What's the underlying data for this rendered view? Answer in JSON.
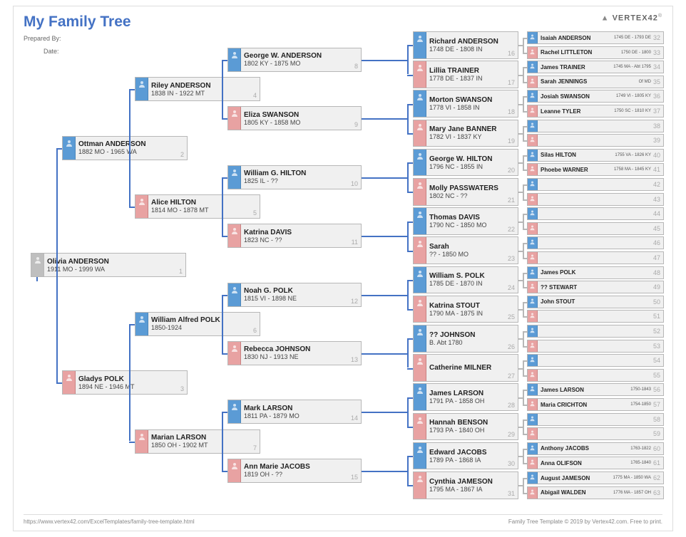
{
  "header": {
    "title": "My Family Tree",
    "prepared_by_label": "Prepared By:",
    "date_label": "Date:",
    "logo": "VERTEX42"
  },
  "footer": {
    "left": "https://www.vertex42.com/ExcelTemplates/family-tree-template.html",
    "right": "Family Tree Template © 2019 by Vertex42.com. Free to print."
  },
  "root": {
    "name": "Olivia ANDERSON",
    "dates": "1911 MO - 1999 WA",
    "num": "1"
  },
  "g2": [
    {
      "name": "Ottman ANDERSON",
      "dates": "1882 MO - 1965 WA",
      "num": "2",
      "sex": "m"
    },
    {
      "name": "Gladys POLK",
      "dates": "1894 NE - 1946 MT",
      "num": "3",
      "sex": "f"
    }
  ],
  "g3": [
    {
      "name": "Riley ANDERSON",
      "dates": "1838 IN - 1922 MT",
      "num": "4",
      "sex": "m"
    },
    {
      "name": "Alice HILTON",
      "dates": "1814 MO - 1878 MT",
      "num": "5",
      "sex": "f"
    },
    {
      "name": "William Alfred POLK",
      "dates": "1850-1924",
      "num": "6",
      "sex": "m"
    },
    {
      "name": "Marian LARSON",
      "dates": "1850 OH - 1902 MT",
      "num": "7",
      "sex": "f"
    }
  ],
  "g4": [
    {
      "name": "George W. ANDERSON",
      "dates": "1802 KY - 1875 MO",
      "num": "8",
      "sex": "m"
    },
    {
      "name": "Eliza SWANSON",
      "dates": "1805 KY - 1858 MO",
      "num": "9",
      "sex": "f"
    },
    {
      "name": "William G. HILTON",
      "dates": "1825 IL - ??",
      "num": "10",
      "sex": "m"
    },
    {
      "name": "Katrina DAVIS",
      "dates": "1823 NC - ??",
      "num": "11",
      "sex": "f"
    },
    {
      "name": "Noah G. POLK",
      "dates": "1815 VI - 1898 NE",
      "num": "12",
      "sex": "m"
    },
    {
      "name": "Rebecca JOHNSON",
      "dates": "1830 NJ - 1913 NE",
      "num": "13",
      "sex": "f"
    },
    {
      "name": "Mark LARSON",
      "dates": "1811 PA - 1879 MO",
      "num": "14",
      "sex": "m"
    },
    {
      "name": "Ann Marie JACOBS",
      "dates": "1819 OH - ??",
      "num": "15",
      "sex": "f"
    }
  ],
  "g5": [
    {
      "name": "Richard ANDERSON",
      "dates": "1748 DE - 1808 IN",
      "num": "16",
      "sex": "m"
    },
    {
      "name": "Lillia TRAINER",
      "dates": "1778 DE - 1837 IN",
      "num": "17",
      "sex": "f"
    },
    {
      "name": "Morton SWANSON",
      "dates": "1778 VI - 1858 IN",
      "num": "18",
      "sex": "m"
    },
    {
      "name": "Mary Jane BANNER",
      "dates": "1782 VI - 1837 KY",
      "num": "19",
      "sex": "f"
    },
    {
      "name": "George W. HILTON",
      "dates": "1796 NC - 1855 IN",
      "num": "20",
      "sex": "m"
    },
    {
      "name": "Molly PASSWATERS",
      "dates": "1802 NC - ??",
      "num": "21",
      "sex": "f"
    },
    {
      "name": "Thomas DAVIS",
      "dates": "1790 NC - 1850 MO",
      "num": "22",
      "sex": "m"
    },
    {
      "name": "Sarah",
      "dates": "?? - 1850 MO",
      "num": "23",
      "sex": "f"
    },
    {
      "name": "William S. POLK",
      "dates": "1785 DE - 1870 IN",
      "num": "24",
      "sex": "m"
    },
    {
      "name": "Katrina STOUT",
      "dates": "1790 MA - 1875 IN",
      "num": "25",
      "sex": "f"
    },
    {
      "name": "?? JOHNSON",
      "dates": "B. Abt 1780",
      "num": "26",
      "sex": "m"
    },
    {
      "name": "Catherine MILNER",
      "dates": "",
      "num": "27",
      "sex": "f"
    },
    {
      "name": "James LARSON",
      "dates": "1791 PA - 1858 OH",
      "num": "28",
      "sex": "m"
    },
    {
      "name": "Hannah BENSON",
      "dates": "1793 PA - 1840 OH",
      "num": "29",
      "sex": "f"
    },
    {
      "name": "Edward JACOBS",
      "dates": "1789 PA - 1868 IA",
      "num": "30",
      "sex": "m"
    },
    {
      "name": "Cynthia JAMESON",
      "dates": "1795 MA - 1867 IA",
      "num": "31",
      "sex": "f"
    }
  ],
  "g6": [
    {
      "name": "Isaiah ANDERSON",
      "dates": "1745 DE - 1793 DE",
      "num": "32",
      "sex": "m"
    },
    {
      "name": "Rachel LITTLETON",
      "dates": "1750 DE - 1800",
      "num": "33",
      "sex": "f"
    },
    {
      "name": "James TRAINER",
      "dates": "1745 MA - Abt 1795",
      "num": "34",
      "sex": "m"
    },
    {
      "name": "Sarah JENNINGS",
      "dates": "Of MD",
      "num": "35",
      "sex": "f"
    },
    {
      "name": "Josiah SWANSON",
      "dates": "1749 VI - 1805 KY",
      "num": "36",
      "sex": "m"
    },
    {
      "name": "Leanne TYLER",
      "dates": "1750 SC - 1810 KY",
      "num": "37",
      "sex": "f"
    },
    {
      "name": "",
      "dates": "",
      "num": "38",
      "sex": "m"
    },
    {
      "name": "",
      "dates": "",
      "num": "39",
      "sex": "f"
    },
    {
      "name": "Silas HILTON",
      "dates": "1755 VA - 1826 KY",
      "num": "40",
      "sex": "m"
    },
    {
      "name": "Phoebe WARNER",
      "dates": "1758 MA - 1845 KY",
      "num": "41",
      "sex": "f"
    },
    {
      "name": "",
      "dates": "",
      "num": "42",
      "sex": "m"
    },
    {
      "name": "",
      "dates": "",
      "num": "43",
      "sex": "f"
    },
    {
      "name": "",
      "dates": "",
      "num": "44",
      "sex": "m"
    },
    {
      "name": "",
      "dates": "",
      "num": "45",
      "sex": "f"
    },
    {
      "name": "",
      "dates": "",
      "num": "46",
      "sex": "m"
    },
    {
      "name": "",
      "dates": "",
      "num": "47",
      "sex": "f"
    },
    {
      "name": "James POLK",
      "dates": "",
      "num": "48",
      "sex": "m"
    },
    {
      "name": "?? STEWART",
      "dates": "",
      "num": "49",
      "sex": "f"
    },
    {
      "name": "John STOUT",
      "dates": "",
      "num": "50",
      "sex": "m"
    },
    {
      "name": "",
      "dates": "",
      "num": "51",
      "sex": "f"
    },
    {
      "name": "",
      "dates": "",
      "num": "52",
      "sex": "m"
    },
    {
      "name": "",
      "dates": "",
      "num": "53",
      "sex": "f"
    },
    {
      "name": "",
      "dates": "",
      "num": "54",
      "sex": "m"
    },
    {
      "name": "",
      "dates": "",
      "num": "55",
      "sex": "f"
    },
    {
      "name": "James LARSON",
      "dates": "1750-1843",
      "num": "56",
      "sex": "m"
    },
    {
      "name": "Maria CRICHTON",
      "dates": "1754-1850",
      "num": "57",
      "sex": "f"
    },
    {
      "name": "",
      "dates": "",
      "num": "58",
      "sex": "m"
    },
    {
      "name": "",
      "dates": "",
      "num": "59",
      "sex": "f"
    },
    {
      "name": "Anthony JACOBS",
      "dates": "1763-1822",
      "num": "60",
      "sex": "m"
    },
    {
      "name": "Anna OLIFSON",
      "dates": "1765-1840",
      "num": "61",
      "sex": "f"
    },
    {
      "name": "August JAMESON",
      "dates": "1775 MA - 1850 WA",
      "num": "62",
      "sex": "m"
    },
    {
      "name": "Abigail WALDEN",
      "dates": "1776 MA - 1857 OH",
      "num": "63",
      "sex": "f"
    }
  ]
}
